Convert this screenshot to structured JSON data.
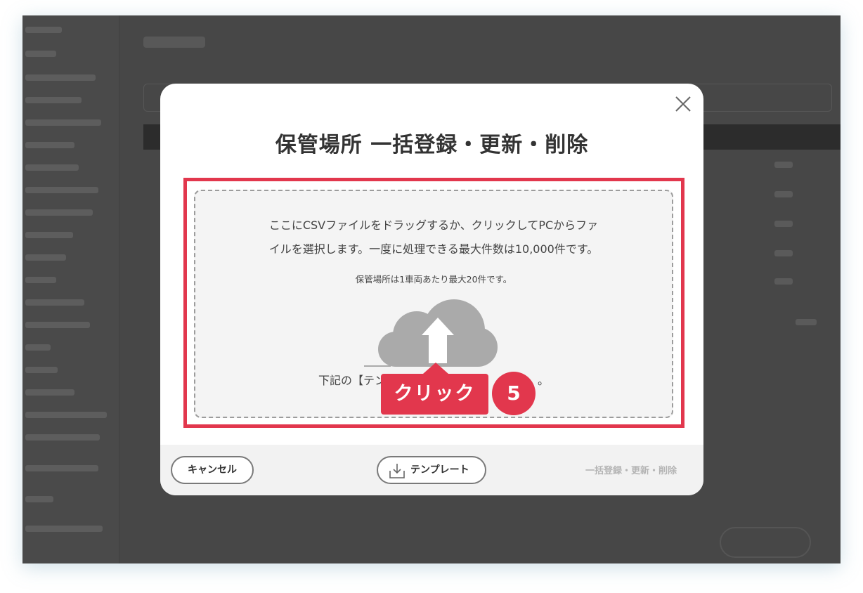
{
  "modal": {
    "title": "保管場所 一括登録・更新・削除",
    "drop_text_line1": "ここにCSVファイルをドラッグするか、クリックしてPCからファ",
    "drop_text_line2": "イルを選択します。一度に処理できる最大件数は10,000件です。",
    "drop_note": "保管場所は1車両あたり最大20件です。",
    "template_hint_visible_start": "下記の【テン",
    "template_hint_visible_end": "。",
    "upload_icon": "cloud-upload-icon",
    "close_icon": "close-icon"
  },
  "annotation": {
    "callout_label": "クリック",
    "step_number": "5",
    "color": "#e2374d"
  },
  "footer": {
    "cancel_label": "キャンセル",
    "template_label": "テンプレート",
    "template_icon": "download-icon",
    "submit_label": "一括登録・更新・削除"
  }
}
